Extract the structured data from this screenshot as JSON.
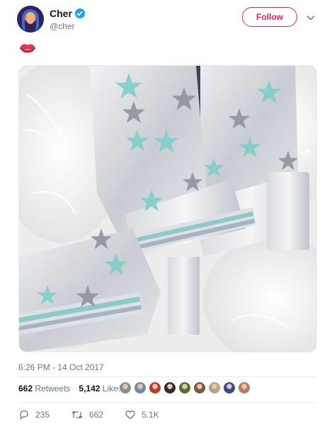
{
  "author": {
    "name": "Cher",
    "handle": "@cher",
    "verified": true
  },
  "follow_button": {
    "label": "Follow",
    "color": "#e0245e"
  },
  "tweet": {
    "content_emoji": "kiss-mark",
    "timestamp": "6:26 PM - 14 Oct 2017",
    "media_description": "silver platform boots with teal and grey stars on white feathers"
  },
  "stats": {
    "retweets_count": "662",
    "retweets_label": "Retweets",
    "likes_count": "5,142",
    "likes_label": "Likes"
  },
  "likers": [
    "#8a8f96",
    "#6f8ca8",
    "#c0392b",
    "#2d2d2d",
    "#5a6b3a",
    "#7a5a3a",
    "#b8a38a",
    "#3a4a8a",
    "#b87a6a"
  ],
  "actions": {
    "replies": "235",
    "retweets": "662",
    "likes": "5.1K"
  },
  "colors": {
    "accent": "#1da1f2",
    "follow": "#e0245e",
    "muted": "#657786"
  }
}
